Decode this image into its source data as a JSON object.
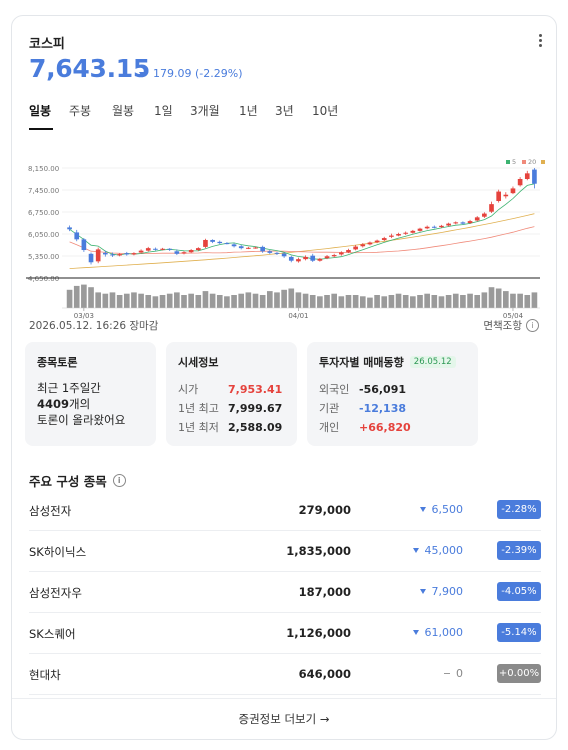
{
  "header": {
    "title": "코스피",
    "price": "7,643.15",
    "change": "179.09 (-2.29%)"
  },
  "tabs": [
    "일봉",
    "주봉",
    "월봉",
    "1일",
    "3개월",
    "1년",
    "3년",
    "10년"
  ],
  "chart_data": {
    "type": "candlestick",
    "y_ticks": [
      "8,150.00",
      "7,450.00",
      "6,750.00",
      "6,050.00",
      "5,350.00",
      "4,650.00"
    ],
    "x_ticks": [
      "03/03",
      "04/01",
      "05/04"
    ],
    "legend": [
      "5",
      "20",
      "60"
    ],
    "ylim": [
      4650,
      8150
    ],
    "candles": [
      [
        6260,
        6200,
        6320,
        6140
      ],
      [
        6100,
        5880,
        6180,
        5820
      ],
      [
        5880,
        5540,
        5920,
        5480
      ],
      [
        5420,
        5150,
        5460,
        5080
      ],
      [
        5180,
        5560,
        5620,
        5120
      ],
      [
        5450,
        5400,
        5520,
        5330
      ],
      [
        5400,
        5380,
        5460,
        5320
      ],
      [
        5370,
        5410,
        5440,
        5340
      ],
      [
        5440,
        5400,
        5480,
        5360
      ],
      [
        5400,
        5440,
        5470,
        5370
      ],
      [
        5460,
        5520,
        5560,
        5430
      ],
      [
        5520,
        5600,
        5640,
        5490
      ],
      [
        5580,
        5560,
        5620,
        5520
      ],
      [
        5560,
        5580,
        5610,
        5530
      ],
      [
        5580,
        5550,
        5600,
        5510
      ],
      [
        5500,
        5420,
        5560,
        5380
      ],
      [
        5430,
        5470,
        5500,
        5400
      ],
      [
        5470,
        5540,
        5570,
        5440
      ],
      [
        5540,
        5600,
        5630,
        5510
      ],
      [
        5640,
        5860,
        5900,
        5600
      ],
      [
        5860,
        5800,
        5880,
        5760
      ],
      [
        5800,
        5760,
        5840,
        5730
      ],
      [
        5760,
        5750,
        5790,
        5720
      ],
      [
        5720,
        5660,
        5760,
        5620
      ],
      [
        5660,
        5600,
        5700,
        5560
      ],
      [
        5600,
        5610,
        5640,
        5570
      ],
      [
        5610,
        5620,
        5650,
        5580
      ],
      [
        5640,
        5500,
        5680,
        5450
      ],
      [
        5500,
        5450,
        5540,
        5410
      ],
      [
        5450,
        5430,
        5480,
        5380
      ],
      [
        5430,
        5340,
        5460,
        5290
      ],
      [
        5320,
        5200,
        5360,
        5150
      ],
      [
        5180,
        5250,
        5300,
        5140
      ],
      [
        5250,
        5320,
        5370,
        5210
      ],
      [
        5360,
        5200,
        5420,
        5160
      ],
      [
        5200,
        5260,
        5290,
        5170
      ],
      [
        5280,
        5340,
        5380,
        5250
      ],
      [
        5340,
        5380,
        5420,
        5310
      ],
      [
        5400,
        5460,
        5500,
        5360
      ],
      [
        5470,
        5540,
        5580,
        5440
      ],
      [
        5560,
        5650,
        5700,
        5530
      ],
      [
        5660,
        5720,
        5760,
        5620
      ],
      [
        5720,
        5780,
        5810,
        5690
      ],
      [
        5790,
        5840,
        5870,
        5760
      ],
      [
        5860,
        5920,
        5960,
        5820
      ],
      [
        5960,
        6000,
        6060,
        5920
      ],
      [
        6000,
        6050,
        6090,
        5980
      ],
      [
        6060,
        6090,
        6130,
        6020
      ],
      [
        6090,
        6150,
        6180,
        6060
      ],
      [
        6150,
        6220,
        6250,
        6120
      ],
      [
        6230,
        6280,
        6320,
        6200
      ],
      [
        6280,
        6260,
        6320,
        6230
      ],
      [
        6270,
        6310,
        6340,
        6240
      ],
      [
        6320,
        6380,
        6410,
        6290
      ],
      [
        6390,
        6420,
        6450,
        6360
      ],
      [
        6420,
        6380,
        6450,
        6350
      ],
      [
        6400,
        6460,
        6500,
        6370
      ],
      [
        6480,
        6580,
        6620,
        6450
      ],
      [
        6600,
        6700,
        6740,
        6560
      ],
      [
        6760,
        7000,
        7080,
        6720
      ],
      [
        7100,
        7400,
        7460,
        7050
      ],
      [
        7250,
        7300,
        7380,
        7180
      ],
      [
        7350,
        7500,
        7560,
        7320
      ],
      [
        7600,
        7800,
        7860,
        7560
      ],
      [
        7800,
        7980,
        8060,
        7760
      ],
      [
        8100,
        7650,
        8150,
        7500
      ]
    ],
    "volume": [
      0.7,
      0.85,
      0.9,
      0.8,
      0.6,
      0.55,
      0.6,
      0.5,
      0.55,
      0.6,
      0.55,
      0.5,
      0.45,
      0.5,
      0.55,
      0.6,
      0.5,
      0.55,
      0.5,
      0.65,
      0.55,
      0.5,
      0.45,
      0.5,
      0.55,
      0.6,
      0.55,
      0.5,
      0.65,
      0.6,
      0.7,
      0.75,
      0.6,
      0.55,
      0.5,
      0.45,
      0.5,
      0.55,
      0.45,
      0.5,
      0.5,
      0.45,
      0.4,
      0.5,
      0.45,
      0.5,
      0.55,
      0.5,
      0.45,
      0.5,
      0.55,
      0.5,
      0.45,
      0.5,
      0.55,
      0.5,
      0.55,
      0.5,
      0.6,
      0.8,
      0.75,
      0.65,
      0.55,
      0.55,
      0.5,
      0.6
    ]
  },
  "date_line": "2026.05.12. 16:26 장마감",
  "disclaimer": "면책조항",
  "forum": {
    "title": "종목토론",
    "line1": "최근 1주일간",
    "count": "4409",
    "count_suffix": "개의",
    "line3": "토론이 올라왔어요"
  },
  "market_info": {
    "title": "시세정보",
    "rows": [
      {
        "label": "시가",
        "value": "7,953.41"
      },
      {
        "label": "1년 최고",
        "value": "7,999.67"
      },
      {
        "label": "1년 최저",
        "value": "2,588.09"
      }
    ]
  },
  "investor": {
    "title": "투자자별 매매동향",
    "date": "26.05.12",
    "rows": [
      {
        "label": "외국인",
        "value": "-56,091"
      },
      {
        "label": "기관",
        "value": "-12,138"
      },
      {
        "label": "개인",
        "value": "+66,820"
      }
    ]
  },
  "constituents": {
    "title": "주요 구성 종목",
    "rows": [
      {
        "name": "삼성전자",
        "price": "279,000",
        "change": "6,500",
        "pct": "-2.28%"
      },
      {
        "name": "SK하이닉스",
        "price": "1,835,000",
        "change": "45,000",
        "pct": "-2.39%"
      },
      {
        "name": "삼성전자우",
        "price": "187,000",
        "change": "7,900",
        "pct": "-4.05%"
      },
      {
        "name": "SK스퀘어",
        "price": "1,126,000",
        "change": "61,000",
        "pct": "-5.14%"
      },
      {
        "name": "현대차",
        "price": "646,000",
        "change": "0",
        "pct": "+0.00%"
      }
    ]
  },
  "footer": "증권정보 더보기 →",
  "colors": {
    "up": "#e5423c",
    "down": "#4a7cdc",
    "ma5": "#3cb371",
    "ma20": "#f08a7a",
    "ma60": "#e0b050"
  }
}
